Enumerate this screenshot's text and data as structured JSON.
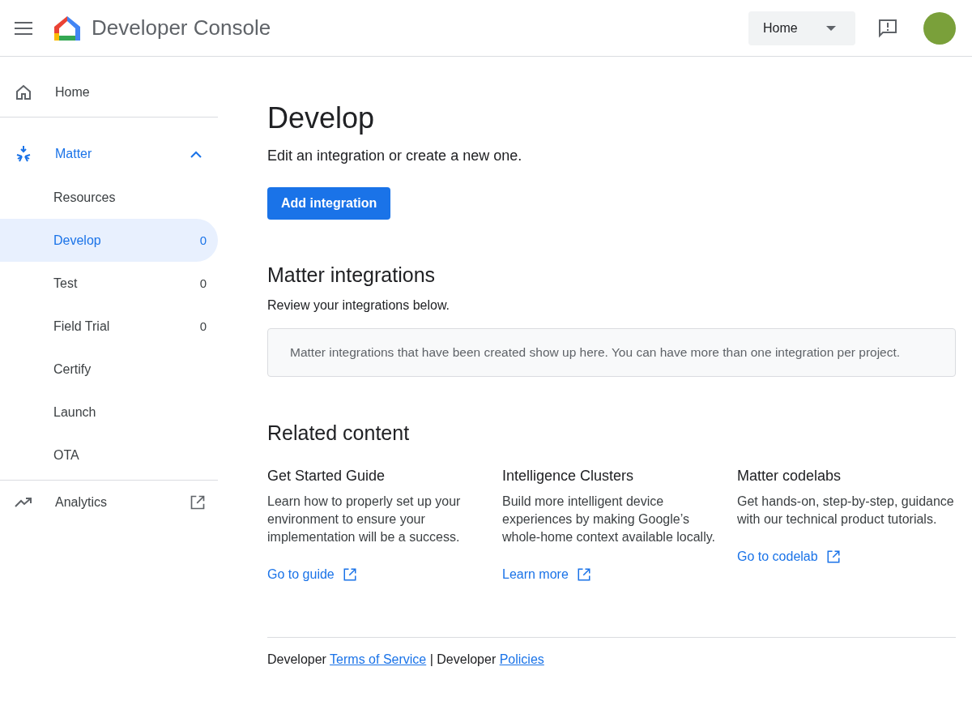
{
  "header": {
    "title": "Developer Console",
    "project_select": {
      "value": "Home"
    }
  },
  "sidebar": {
    "home": {
      "label": "Home"
    },
    "section": {
      "label": "Matter",
      "expanded": true,
      "items": [
        {
          "label": "Resources",
          "selected": false
        },
        {
          "label": "Develop",
          "count": "0",
          "selected": true
        },
        {
          "label": "Test",
          "count": "0",
          "selected": false
        },
        {
          "label": "Field Trial",
          "count": "0",
          "selected": false
        },
        {
          "label": "Certify",
          "selected": false
        },
        {
          "label": "Launch",
          "selected": false
        },
        {
          "label": "OTA",
          "selected": false
        }
      ]
    },
    "analytics": {
      "label": "Analytics"
    }
  },
  "main": {
    "title": "Develop",
    "subtitle": "Edit an integration or create a new one.",
    "add_button": "Add integration",
    "integrations": {
      "title": "Matter integrations",
      "subtitle": "Review your integrations below.",
      "empty_note": "Matter integrations that have been created show up here. You can have more than one integration per project."
    },
    "related": {
      "title": "Related content",
      "cards": [
        {
          "title": "Get Started Guide",
          "text": "Learn how to properly set up your environment to ensure your implementation will be a success.",
          "link": "Go to guide"
        },
        {
          "title": "Intelligence Clusters",
          "text": "Build more intelligent device experiences by making Google’s whole-home context available locally.",
          "link": "Learn more"
        },
        {
          "title": "Matter codelabs",
          "text": "Get hands-on, step-by-step, guidance with our technical product tutorials.",
          "link": "Go to codelab"
        }
      ]
    },
    "footer": [
      {
        "text": "Developer ",
        "link": false
      },
      {
        "text": "Terms of Service",
        "link": true
      },
      {
        "text": " | Developer ",
        "link": false
      },
      {
        "text": "Policies",
        "link": true
      }
    ]
  }
}
